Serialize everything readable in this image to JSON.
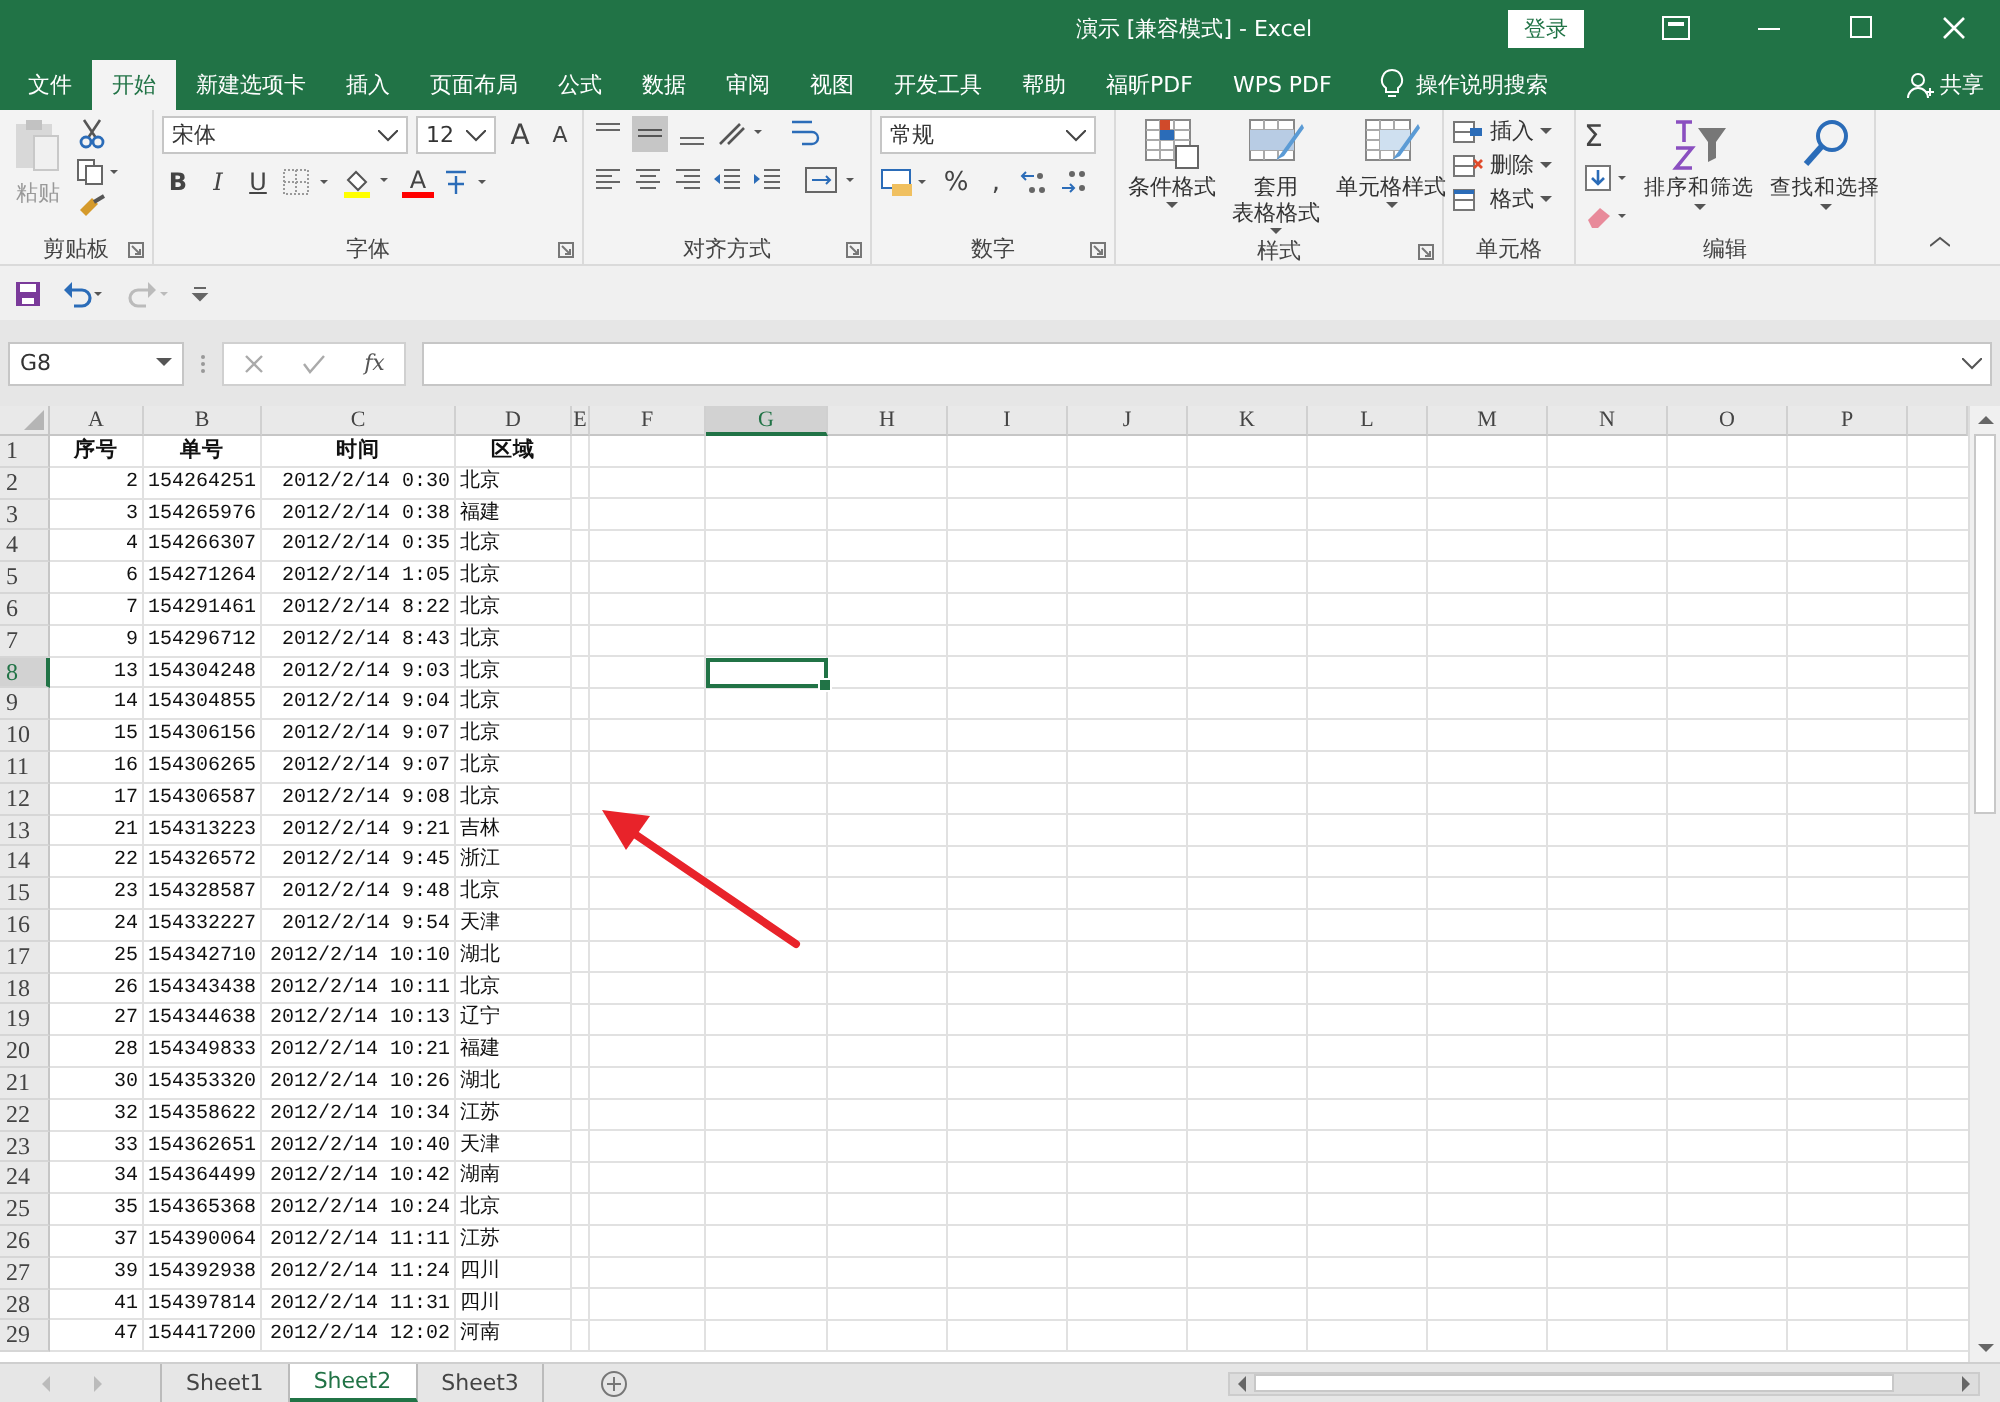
{
  "window": {
    "title": "演示  [兼容模式]  -  Excel",
    "login": "登录"
  },
  "menu_tabs": [
    {
      "label": "文件",
      "selected": false
    },
    {
      "label": "开始",
      "selected": true
    },
    {
      "label": "新建选项卡",
      "selected": false
    },
    {
      "label": "插入",
      "selected": false
    },
    {
      "label": "页面布局",
      "selected": false
    },
    {
      "label": "公式",
      "selected": false
    },
    {
      "label": "数据",
      "selected": false
    },
    {
      "label": "审阅",
      "selected": false
    },
    {
      "label": "视图",
      "selected": false
    },
    {
      "label": "开发工具",
      "selected": false
    },
    {
      "label": "帮助",
      "selected": false
    },
    {
      "label": "福昕PDF",
      "selected": false
    },
    {
      "label": "WPS PDF",
      "selected": false
    }
  ],
  "tell_me": "操作说明搜索",
  "share": "共享",
  "ribbon": {
    "clipboard": {
      "paste": "粘贴",
      "label": "剪贴板"
    },
    "font": {
      "name": "宋体",
      "size": "12",
      "grow": "A",
      "shrink": "A",
      "styles": [
        "B",
        "I",
        "U"
      ],
      "color_letter": "A",
      "label": "字体"
    },
    "alignment": {
      "label": "对齐方式"
    },
    "number": {
      "format": "常规",
      "percent": "%",
      "comma": ",",
      "label": "数字"
    },
    "styles": {
      "buttons": [
        [
          "条件格式"
        ],
        [
          "套用",
          "表格格式"
        ],
        [
          "单元格样式"
        ]
      ],
      "label": "样式"
    },
    "cells": {
      "buttons": [
        "插入",
        "删除",
        "格式"
      ],
      "label": "单元格"
    },
    "editing": {
      "sum": "Σ",
      "buttons": [
        "排序和筛选",
        "查找和选择"
      ],
      "label": "编辑"
    }
  },
  "formula_bar": {
    "name_box": "G8",
    "fx": "fx"
  },
  "sheet": {
    "columns": [
      {
        "label": "A",
        "selected": false
      },
      {
        "label": "B",
        "selected": false
      },
      {
        "label": "C",
        "selected": false
      },
      {
        "label": "D",
        "selected": false
      },
      {
        "label": "E",
        "selected": false
      },
      {
        "label": "F",
        "selected": false
      },
      {
        "label": "G",
        "selected": true
      },
      {
        "label": "H",
        "selected": false
      },
      {
        "label": "I",
        "selected": false
      },
      {
        "label": "J",
        "selected": false
      },
      {
        "label": "K",
        "selected": false
      },
      {
        "label": "L",
        "selected": false
      },
      {
        "label": "M",
        "selected": false
      },
      {
        "label": "N",
        "selected": false
      },
      {
        "label": "O",
        "selected": false
      },
      {
        "label": "P",
        "selected": false
      }
    ],
    "rows": [
      {
        "number": "1",
        "selected": false,
        "kind": "header",
        "cells": [
          "序号",
          "单号",
          "时间",
          "区域"
        ]
      },
      {
        "number": "2",
        "selected": false,
        "kind": "data",
        "cells": [
          "2",
          "154264251",
          "2012/2/14 0:30",
          "北京"
        ]
      },
      {
        "number": "3",
        "selected": false,
        "kind": "data",
        "cells": [
          "3",
          "154265976",
          "2012/2/14 0:38",
          "福建"
        ]
      },
      {
        "number": "4",
        "selected": false,
        "kind": "data",
        "cells": [
          "4",
          "154266307",
          "2012/2/14 0:35",
          "北京"
        ]
      },
      {
        "number": "5",
        "selected": false,
        "kind": "data",
        "cells": [
          "6",
          "154271264",
          "2012/2/14 1:05",
          "北京"
        ]
      },
      {
        "number": "6",
        "selected": false,
        "kind": "data",
        "cells": [
          "7",
          "154291461",
          "2012/2/14 8:22",
          "北京"
        ]
      },
      {
        "number": "7",
        "selected": false,
        "kind": "data",
        "cells": [
          "9",
          "154296712",
          "2012/2/14 8:43",
          "北京"
        ]
      },
      {
        "number": "8",
        "selected": true,
        "kind": "data",
        "cells": [
          "13",
          "154304248",
          "2012/2/14 9:03",
          "北京"
        ]
      },
      {
        "number": "9",
        "selected": false,
        "kind": "data",
        "cells": [
          "14",
          "154304855",
          "2012/2/14 9:04",
          "北京"
        ]
      },
      {
        "number": "10",
        "selected": false,
        "kind": "data",
        "cells": [
          "15",
          "154306156",
          "2012/2/14 9:07",
          "北京"
        ]
      },
      {
        "number": "11",
        "selected": false,
        "kind": "data",
        "cells": [
          "16",
          "154306265",
          "2012/2/14 9:07",
          "北京"
        ]
      },
      {
        "number": "12",
        "selected": false,
        "kind": "data",
        "cells": [
          "17",
          "154306587",
          "2012/2/14 9:08",
          "北京"
        ]
      },
      {
        "number": "13",
        "selected": false,
        "kind": "data",
        "cells": [
          "21",
          "154313223",
          "2012/2/14 9:21",
          "吉林"
        ]
      },
      {
        "number": "14",
        "selected": false,
        "kind": "data",
        "cells": [
          "22",
          "154326572",
          "2012/2/14 9:45",
          "浙江"
        ]
      },
      {
        "number": "15",
        "selected": false,
        "kind": "data",
        "cells": [
          "23",
          "154328587",
          "2012/2/14 9:48",
          "北京"
        ]
      },
      {
        "number": "16",
        "selected": false,
        "kind": "data",
        "cells": [
          "24",
          "154332227",
          "2012/2/14 9:54",
          "天津"
        ]
      },
      {
        "number": "17",
        "selected": false,
        "kind": "data",
        "cells": [
          "25",
          "154342710",
          "2012/2/14 10:10",
          "湖北"
        ]
      },
      {
        "number": "18",
        "selected": false,
        "kind": "data",
        "cells": [
          "26",
          "154343438",
          "2012/2/14 10:11",
          "北京"
        ]
      },
      {
        "number": "19",
        "selected": false,
        "kind": "data",
        "cells": [
          "27",
          "154344638",
          "2012/2/14 10:13",
          "辽宁"
        ]
      },
      {
        "number": "20",
        "selected": false,
        "kind": "data",
        "cells": [
          "28",
          "154349833",
          "2012/2/14 10:21",
          "福建"
        ]
      },
      {
        "number": "21",
        "selected": false,
        "kind": "data",
        "cells": [
          "30",
          "154353320",
          "2012/2/14 10:26",
          "湖北"
        ]
      },
      {
        "number": "22",
        "selected": false,
        "kind": "data",
        "cells": [
          "32",
          "154358622",
          "2012/2/14 10:34",
          "江苏"
        ]
      },
      {
        "number": "23",
        "selected": false,
        "kind": "data",
        "cells": [
          "33",
          "154362651",
          "2012/2/14 10:40",
          "天津"
        ]
      },
      {
        "number": "24",
        "selected": false,
        "kind": "data",
        "cells": [
          "34",
          "154364499",
          "2012/2/14 10:42",
          "湖南"
        ]
      },
      {
        "number": "25",
        "selected": false,
        "kind": "data",
        "cells": [
          "35",
          "154365368",
          "2012/2/14 10:24",
          "北京"
        ]
      },
      {
        "number": "26",
        "selected": false,
        "kind": "data",
        "cells": [
          "37",
          "154390064",
          "2012/2/14 11:11",
          "江苏"
        ]
      },
      {
        "number": "27",
        "selected": false,
        "kind": "data",
        "cells": [
          "39",
          "154392938",
          "2012/2/14 11:24",
          "四川"
        ]
      },
      {
        "number": "28",
        "selected": false,
        "kind": "data",
        "cells": [
          "41",
          "154397814",
          "2012/2/14 11:31",
          "四川"
        ]
      },
      {
        "number": "29",
        "selected": false,
        "kind": "data",
        "cells": [
          "47",
          "154417200",
          "2012/2/14 12:02",
          "河南"
        ]
      }
    ]
  },
  "sheet_tabs": [
    {
      "label": "Sheet1",
      "selected": false
    },
    {
      "label": "Sheet2",
      "selected": true
    },
    {
      "label": "Sheet3",
      "selected": false
    }
  ]
}
